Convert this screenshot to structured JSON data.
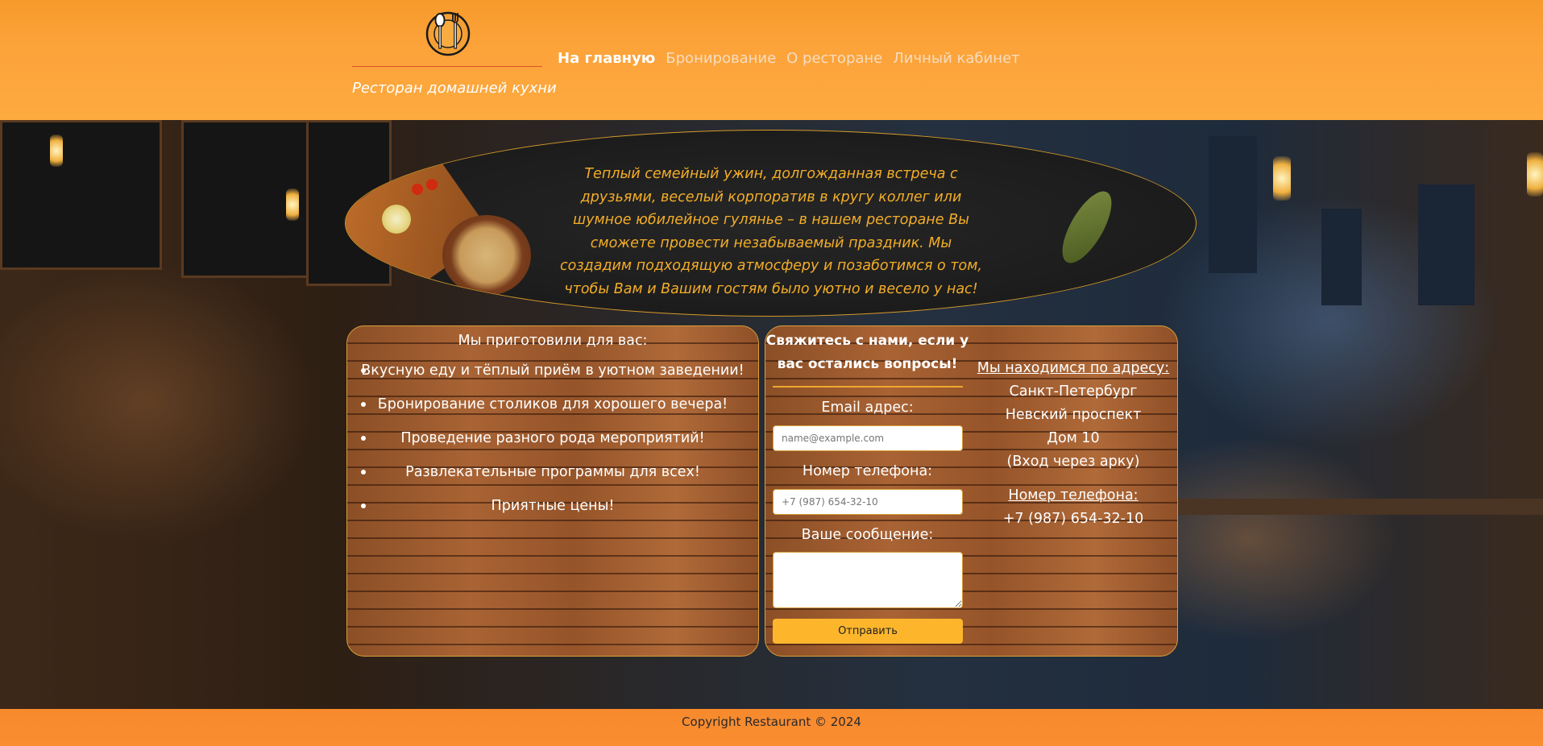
{
  "header": {
    "tagline": "Ресторан домашней кухни",
    "nav": [
      {
        "label": "На главную",
        "active": true
      },
      {
        "label": "Бронирование",
        "active": false
      },
      {
        "label": "О ресторане",
        "active": false
      },
      {
        "label": "Личный кабинет",
        "active": false
      }
    ],
    "logo_icon": "plate-spoon-fork-icon"
  },
  "banner": {
    "text": "Теплый семейный ужин, долгожданная встреча с друзьями, веселый корпоратив в кругу коллег или шумное юбилейное гулянье – в нашем ресторане Вы сможете провести незабываемый праздник. Мы создадим подходящую атмосферу и позаботимся о том, чтобы Вам и Вашим гостям было уютно и весело у нас!"
  },
  "offer": {
    "title": "Мы приготовили для вас:",
    "items": [
      "Вкусную еду и тёплый приём в уютном заведении!",
      "Бронирование столиков для хорошего вечера!",
      "Проведение разного рода мероприятий!",
      "Развлекательные программы для всех!",
      "Приятные цены!"
    ]
  },
  "contact": {
    "title": "Свяжитесь с нами, если у вас остались вопросы!",
    "email_label": "Email адрес:",
    "email_placeholder": "name@example.com",
    "phone_label": "Номер телефона:",
    "phone_placeholder": "+7 (987) 654-32-10",
    "message_label": "Ваше сообщение:",
    "send_label": "Отправить"
  },
  "address": {
    "heading": "Мы находимся по адресу:",
    "lines": [
      "Санкт-Петербург",
      "Невский проспект",
      "Дом 10",
      "(Вход через арку)"
    ],
    "phone_heading": "Номер телефона:",
    "phone": "+7 (987) 654-32-10"
  },
  "footer": {
    "copyright": "Copyright Restaurant © 2024"
  },
  "colors": {
    "header_orange": "#fca33a",
    "accent_gold": "#f3ad28",
    "button": "#fdb62c",
    "footer_orange": "#fa8d30"
  }
}
